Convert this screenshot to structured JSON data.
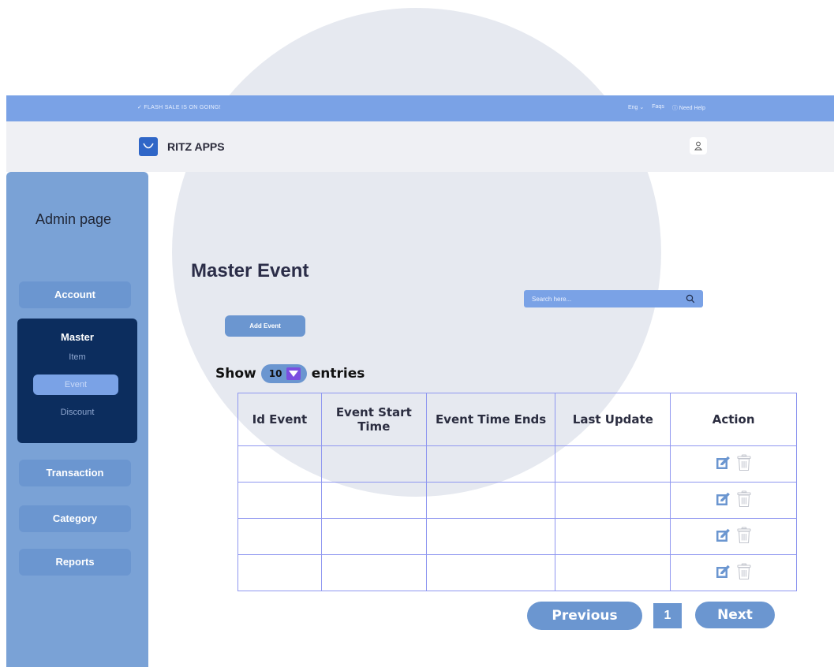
{
  "topbar": {
    "promo": "✓  FLASH SALE IS ON GOING!",
    "language": "Eng ⌄",
    "faqs": "Faqs",
    "help": "ⓘ Need Help"
  },
  "header": {
    "brand": "RITZ APPS"
  },
  "sidebar": {
    "title": "Admin page",
    "account": "Account",
    "master": {
      "label": "Master",
      "items": [
        "Item",
        "Event",
        "Discount"
      ],
      "active": "Event"
    },
    "transaction": "Transaction",
    "category": "Category",
    "reports": "Reports"
  },
  "main": {
    "title": "Master Event",
    "search_placeholder": "Search here...",
    "add_button": "Add Event",
    "show_label": "Show",
    "entries_value": "10",
    "entries_label": "entries"
  },
  "table": {
    "headers": [
      "Id Event",
      "Event Start Time",
      "Event Time Ends",
      "Last Update",
      "Action"
    ],
    "rows": [
      [
        "",
        "",
        "",
        ""
      ],
      [
        "",
        "",
        "",
        ""
      ],
      [
        "",
        "",
        "",
        ""
      ],
      [
        "",
        "",
        "",
        ""
      ]
    ]
  },
  "pagination": {
    "previous": "Previous",
    "page": "1",
    "next": "Next"
  },
  "colors": {
    "accent": "#7aa2e6",
    "button": "#6b96d0",
    "sidebar": "#7aa2d6",
    "sidebar_group": "#0c2d5e",
    "table_border": "#8f97f0"
  },
  "icons": {
    "logo": "shopping-bag-icon",
    "user": "user-icon",
    "search": "search-icon",
    "edit": "edit-icon",
    "delete": "trash-icon",
    "dropdown": "dropdown-arrow-icon"
  }
}
